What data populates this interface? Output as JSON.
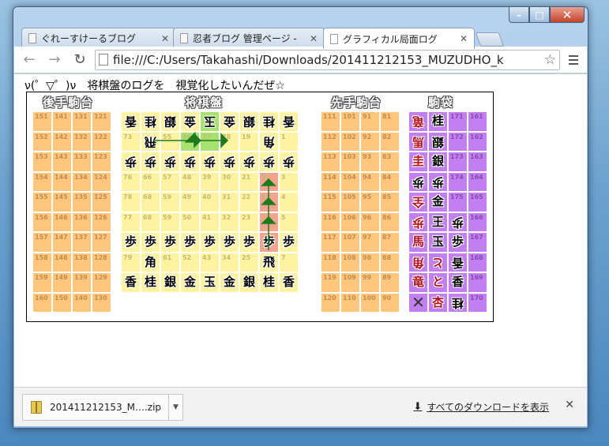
{
  "window": {
    "min": "–",
    "max": "□",
    "close": "✕"
  },
  "tabs": [
    {
      "label": "ぐれーすけーるブログ",
      "close": "✕"
    },
    {
      "label": "忍者ブログ 管理ページ -",
      "close": "✕"
    },
    {
      "label": "グラフィカル局面ログ",
      "close": "✕"
    }
  ],
  "toolbar": {
    "back": "←",
    "forward": "→",
    "reload": "↻",
    "url": "file:///C:/Users/Takahashi/Downloads/201411212153_MUZUDHO_k",
    "star": "☆"
  },
  "page": {
    "heading": "ν(゜▽゜)ν　将棋盤のログを　視覚化したいんだぜ☆",
    "sections": {
      "gote": "後手駒台",
      "board": "将棋盤",
      "sente": "先手駒台",
      "bag": "駒袋"
    },
    "colors": {
      "orange": "#ffc77d",
      "yellow": "#fff3a1",
      "green": "#a8e26e",
      "pink": "#f2a48f",
      "purple": "#c27ff2"
    },
    "gote_dai": [
      [
        "151",
        "141",
        "131",
        "121"
      ],
      [
        "152",
        "142",
        "132",
        "122"
      ],
      [
        "153",
        "143",
        "133",
        "123"
      ],
      [
        "154",
        "144",
        "134",
        "124"
      ],
      [
        "155",
        "145",
        "135",
        "125"
      ],
      [
        "156",
        "146",
        "136",
        "126"
      ],
      [
        "157",
        "147",
        "137",
        "127"
      ],
      [
        "158",
        "148",
        "138",
        "128"
      ],
      [
        "159",
        "149",
        "139",
        "129"
      ],
      [
        "160",
        "150",
        "140",
        "130"
      ]
    ],
    "sente_dai": [
      [
        "111",
        "101",
        "91",
        "81"
      ],
      [
        "112",
        "102",
        "92",
        "82"
      ],
      [
        "113",
        "103",
        "93",
        "83"
      ],
      [
        "114",
        "104",
        "94",
        "84"
      ],
      [
        "115",
        "105",
        "95",
        "85"
      ],
      [
        "116",
        "106",
        "96",
        "86"
      ],
      [
        "117",
        "107",
        "97",
        "87"
      ],
      [
        "118",
        "108",
        "98",
        "88"
      ],
      [
        "119",
        "109",
        "99",
        "89"
      ],
      [
        "120",
        "110",
        "100",
        "90"
      ]
    ],
    "board": [
      [
        {
          "n": "",
          "p": "香",
          "o": 1
        },
        {
          "n": "",
          "p": "桂",
          "o": 1
        },
        {
          "n": "",
          "p": "銀",
          "o": 1
        },
        {
          "n": "",
          "p": "金",
          "o": 1
        },
        {
          "n": "",
          "p": "玉",
          "o": 1,
          "c": "g"
        },
        {
          "n": "",
          "p": "金",
          "o": 1
        },
        {
          "n": "",
          "p": "銀",
          "o": 1
        },
        {
          "n": "",
          "p": "桂",
          "o": 1
        },
        {
          "n": "",
          "p": "香",
          "o": 1
        }
      ],
      [
        {
          "n": "73",
          "p": ""
        },
        {
          "n": "",
          "p": "飛",
          "o": 1
        },
        {
          "n": "55",
          "p": ""
        },
        {
          "n": "46",
          "p": "",
          "c": "g"
        },
        {
          "n": "37",
          "p": "",
          "c": "g"
        },
        {
          "n": "28",
          "p": ""
        },
        {
          "n": "19",
          "p": ""
        },
        {
          "n": "",
          "p": "角",
          "o": 1
        },
        {
          "n": "1",
          "p": ""
        }
      ],
      [
        {
          "n": "",
          "p": "歩",
          "o": 1
        },
        {
          "n": "",
          "p": "歩",
          "o": 1
        },
        {
          "n": "",
          "p": "歩",
          "o": 1
        },
        {
          "n": "",
          "p": "歩",
          "o": 1
        },
        {
          "n": "",
          "p": "歩",
          "o": 1
        },
        {
          "n": "",
          "p": "歩",
          "o": 1
        },
        {
          "n": "",
          "p": "歩",
          "o": 1
        },
        {
          "n": "",
          "p": "歩",
          "o": 1
        },
        {
          "n": "",
          "p": "歩",
          "o": 1
        }
      ],
      [
        {
          "n": "76",
          "p": ""
        },
        {
          "n": "66",
          "p": ""
        },
        {
          "n": "57",
          "p": ""
        },
        {
          "n": "48",
          "p": ""
        },
        {
          "n": "39",
          "p": ""
        },
        {
          "n": "30",
          "p": ""
        },
        {
          "n": "21",
          "p": ""
        },
        {
          "n": "12",
          "p": "",
          "c": "r"
        },
        {
          "n": "3",
          "p": ""
        }
      ],
      [
        {
          "n": "78",
          "p": ""
        },
        {
          "n": "68",
          "p": ""
        },
        {
          "n": "59",
          "p": ""
        },
        {
          "n": "49",
          "p": ""
        },
        {
          "n": "40",
          "p": ""
        },
        {
          "n": "31",
          "p": ""
        },
        {
          "n": "22",
          "p": ""
        },
        {
          "n": "13",
          "p": "",
          "c": "r"
        },
        {
          "n": "4",
          "p": ""
        }
      ],
      [
        {
          "n": "77",
          "p": ""
        },
        {
          "n": "68",
          "p": ""
        },
        {
          "n": "59",
          "p": ""
        },
        {
          "n": "50",
          "p": ""
        },
        {
          "n": "41",
          "p": ""
        },
        {
          "n": "32",
          "p": ""
        },
        {
          "n": "23",
          "p": ""
        },
        {
          "n": "14",
          "p": "",
          "c": "r"
        },
        {
          "n": "5",
          "p": ""
        }
      ],
      [
        {
          "n": "",
          "p": "歩"
        },
        {
          "n": "",
          "p": "歩"
        },
        {
          "n": "",
          "p": "歩"
        },
        {
          "n": "",
          "p": "歩"
        },
        {
          "n": "",
          "p": "歩"
        },
        {
          "n": "",
          "p": "歩"
        },
        {
          "n": "",
          "p": "歩"
        },
        {
          "n": "",
          "p": "歩",
          "c": "r"
        },
        {
          "n": "",
          "p": "歩"
        }
      ],
      [
        {
          "n": "79",
          "p": ""
        },
        {
          "n": "",
          "p": "角"
        },
        {
          "n": "61",
          "p": ""
        },
        {
          "n": "52",
          "p": ""
        },
        {
          "n": "43",
          "p": ""
        },
        {
          "n": "34",
          "p": ""
        },
        {
          "n": "25",
          "p": ""
        },
        {
          "n": "",
          "p": "飛"
        },
        {
          "n": "7",
          "p": ""
        }
      ],
      [
        {
          "n": "",
          "p": "香"
        },
        {
          "n": "",
          "p": "桂"
        },
        {
          "n": "",
          "p": "銀"
        },
        {
          "n": "",
          "p": "金"
        },
        {
          "n": "",
          "p": "玉"
        },
        {
          "n": "",
          "p": "金"
        },
        {
          "n": "",
          "p": "銀"
        },
        {
          "n": "",
          "p": "桂"
        },
        {
          "n": "",
          "p": "香"
        }
      ]
    ],
    "komabukuro": [
      [
        {
          "n": "",
          "p": "竜",
          "o": 1,
          "r": 1
        },
        {
          "n": "",
          "p": "桂"
        },
        {
          "n": "171",
          "p": ""
        },
        {
          "n": "161",
          "p": ""
        }
      ],
      [
        {
          "n": "",
          "p": "馬",
          "o": 1,
          "r": 1
        },
        {
          "n": "",
          "p": "銀",
          "o": 1
        },
        {
          "n": "172",
          "p": ""
        },
        {
          "n": "162",
          "p": ""
        }
      ],
      [
        {
          "n": "",
          "p": "圭",
          "r": 1
        },
        {
          "n": "",
          "p": "銀"
        },
        {
          "n": "173",
          "p": ""
        },
        {
          "n": "163",
          "p": ""
        }
      ],
      [
        {
          "n": "",
          "p": "歩",
          "o": 1
        },
        {
          "n": "",
          "p": "歩",
          "o": 1
        },
        {
          "n": "174",
          "p": ""
        },
        {
          "n": "164",
          "p": ""
        }
      ],
      [
        {
          "n": "",
          "p": "全",
          "o": 1,
          "r": 1
        },
        {
          "n": "",
          "p": "金"
        },
        {
          "n": "175",
          "p": ""
        },
        {
          "n": "165",
          "p": ""
        }
      ],
      [
        {
          "n": "",
          "p": "歩",
          "o": 1,
          "r": 1
        },
        {
          "n": "",
          "p": "王"
        },
        {
          "n": "",
          "p": "歩",
          "o": 1
        },
        {
          "n": "166",
          "p": ""
        }
      ],
      [
        {
          "n": "",
          "p": "馬",
          "r": 1
        },
        {
          "n": "",
          "p": "玉"
        },
        {
          "n": "",
          "p": "歩"
        },
        {
          "n": "167",
          "p": ""
        }
      ],
      [
        {
          "n": "",
          "p": "角",
          "o": 1,
          "r": 1
        },
        {
          "n": "",
          "p": "と",
          "o": 1,
          "r": 1
        },
        {
          "n": "",
          "p": "香",
          "o": 1
        },
        {
          "n": "168",
          "p": ""
        }
      ],
      [
        {
          "n": "",
          "p": "竜",
          "r": 1
        },
        {
          "n": "",
          "p": "と",
          "r": 1
        },
        {
          "n": "",
          "p": "香"
        },
        {
          "n": "169",
          "p": ""
        }
      ],
      [
        {
          "n": "",
          "p": "✕",
          "x": 1
        },
        {
          "n": "",
          "p": "杏",
          "r": 1
        },
        {
          "n": "",
          "p": "桂",
          "o": 1
        },
        {
          "n": "170",
          "p": ""
        }
      ]
    ]
  },
  "downloads": {
    "file": "201411212153_M….zip",
    "show_all": "すべてのダウンロードを表示",
    "arrow": "⬇",
    "close": "✕"
  }
}
